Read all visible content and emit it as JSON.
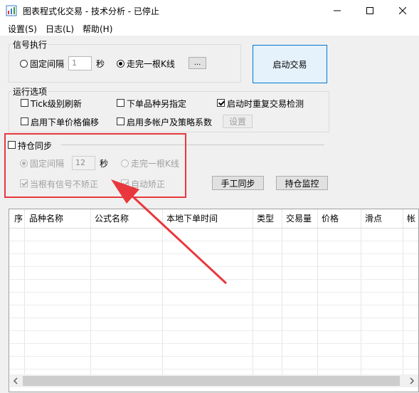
{
  "window": {
    "title": "图表程式化交易 - 技术分析 - 已停止",
    "minimize_icon": "minimize-icon",
    "maximize_icon": "maximize-icon",
    "close_icon": "close-icon"
  },
  "menu": {
    "items": [
      "设置(S)",
      "日志(L)",
      "帮助(H)"
    ]
  },
  "signal_exec": {
    "title": "信号执行",
    "fixed_interval_label": "固定间隔",
    "interval_value": "1",
    "seconds_label": "秒",
    "complete_kline_label": "走完一根K线",
    "more_button": "...",
    "selected": "complete_kline"
  },
  "start_button": "启动交易",
  "run_options": {
    "title": "运行选项",
    "tick_refresh": {
      "label": "Tick级别刷新",
      "checked": false
    },
    "order_other_symbol": {
      "label": "下单品种另指定",
      "checked": false
    },
    "startup_recheck": {
      "label": "启动时重复交易检测",
      "checked": true
    },
    "price_offset": {
      "label": "启用下单价格偏移",
      "checked": false
    },
    "multi_account": {
      "label": "启用多帐户及策略系数",
      "checked": false
    },
    "settings_button": "设置"
  },
  "position_sync": {
    "title": "持仓同步",
    "checked": false,
    "fixed_interval_label": "固定间隔",
    "interval_value": "12",
    "seconds_label": "秒",
    "complete_kline_label": "走完一根K线",
    "selected": "fixed_interval",
    "no_correct_when_signal": {
      "label": "当根有信号不矫正",
      "checked": true
    },
    "auto_correct": {
      "label": "自动矫正",
      "checked": true
    },
    "manual_sync_button": "手工同步",
    "monitor_button": "持仓监控"
  },
  "grid": {
    "columns": [
      "序",
      "品种名称",
      "公式名称",
      "本地下单时间",
      "类型",
      "交易量",
      "价格",
      "滑点",
      "帐"
    ]
  },
  "annotation": {
    "highlight_color": "#e8383d"
  }
}
